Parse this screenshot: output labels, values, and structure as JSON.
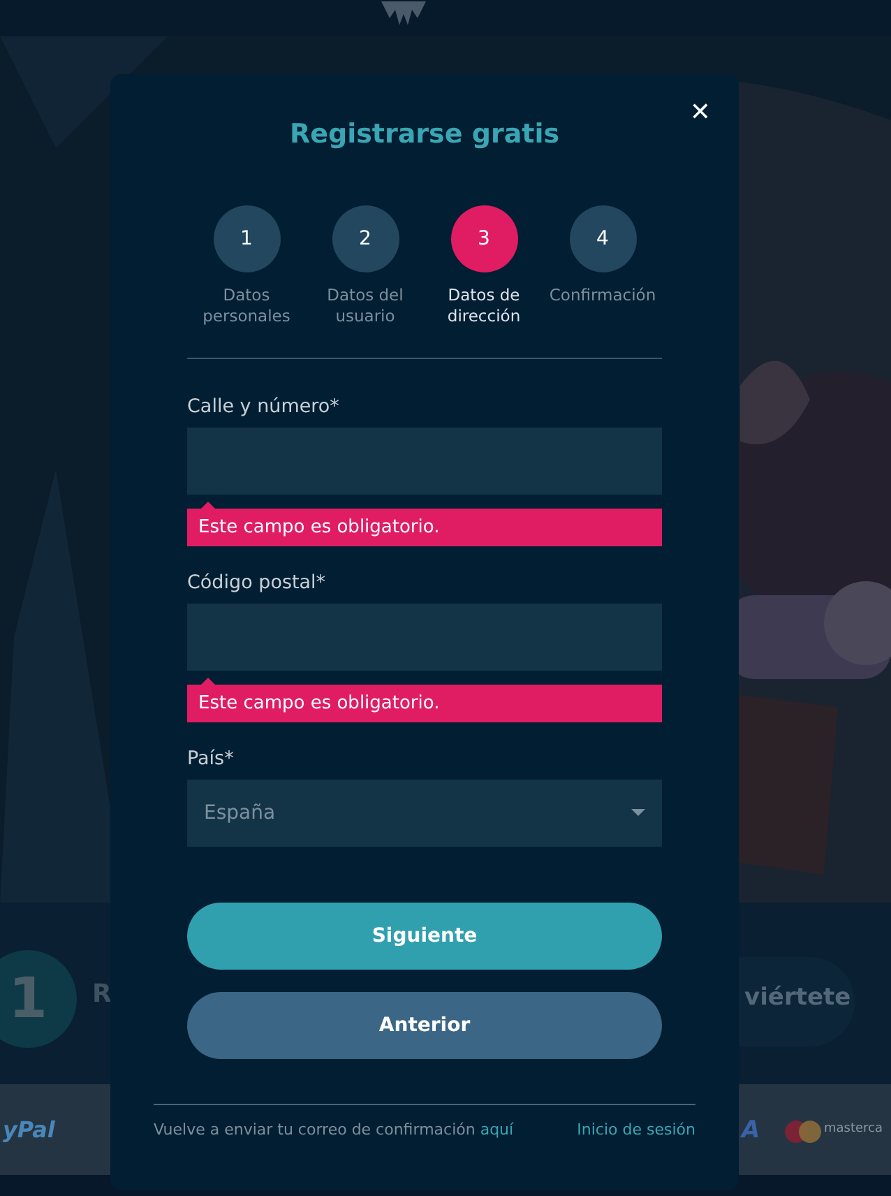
{
  "background": {
    "step_number": "1",
    "step_label": "R",
    "promo_text": "viértete",
    "payment_left": "yPal",
    "payment_mid": "A",
    "payment_right": "masterca"
  },
  "modal": {
    "title": "Registrarse gratis",
    "close": "✕",
    "steps": [
      {
        "number": "1",
        "label": "Datos personales",
        "selected": false
      },
      {
        "number": "2",
        "label": "Datos del usuario",
        "selected": false
      },
      {
        "number": "3",
        "label": "Datos de dirección",
        "selected": true
      },
      {
        "number": "4",
        "label": "Confirmación",
        "selected": false
      }
    ],
    "fields": [
      {
        "kind": "text",
        "label": "Calle y número*",
        "error": "Este campo es obligatorio."
      },
      {
        "kind": "text",
        "label": "Código postal*",
        "error": "Este campo es obligatorio."
      },
      {
        "kind": "select",
        "label": "País*",
        "value": "España"
      }
    ],
    "buttons": [
      {
        "kind": "primary",
        "label": "Siguiente"
      },
      {
        "kind": "secondary",
        "label": "Anterior"
      }
    ],
    "footer": {
      "text": "Vuelve a enviar tu correo de confirmación",
      "link": "aquí",
      "login": "Inicio de sesión"
    }
  }
}
